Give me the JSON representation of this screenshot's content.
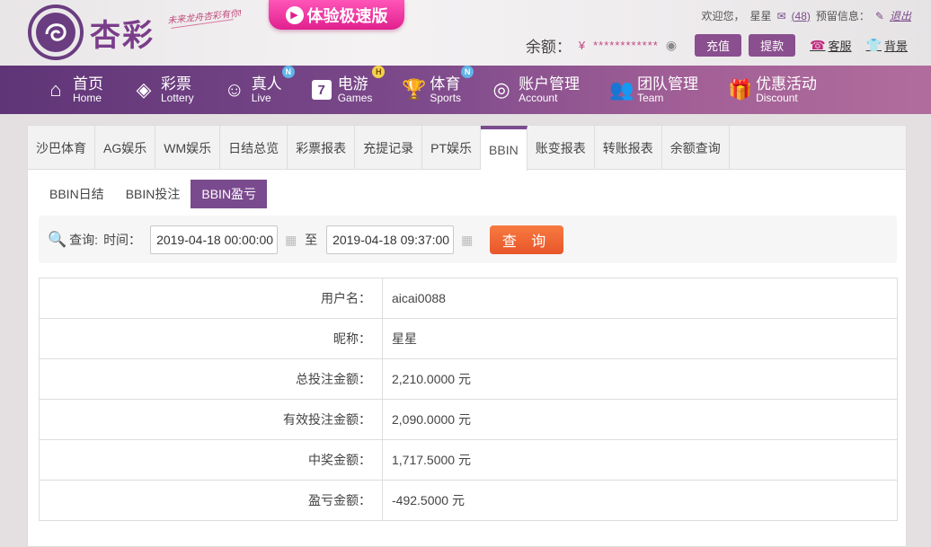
{
  "header": {
    "brand": "杏彩",
    "slogan": "未来龙舟杏彩有你!",
    "promo": "体验极速版",
    "welcome": "欢迎您，",
    "username": "星星",
    "message_count": "(48)",
    "alert_label": "预留信息：",
    "logout": "退出",
    "balance_label": "余额：",
    "balance_currency": "¥",
    "balance_masked": "************",
    "deposit": "充值",
    "withdraw": "提款",
    "service": "客服",
    "background": "背景"
  },
  "nav": [
    {
      "cn": "首页",
      "en": "Home",
      "icon": "home-icon",
      "badge": ""
    },
    {
      "cn": "彩票",
      "en": "Lottery",
      "icon": "lottery-icon",
      "badge": ""
    },
    {
      "cn": "真人",
      "en": "Live",
      "icon": "live-icon",
      "badge": "N"
    },
    {
      "cn": "电游",
      "en": "Games",
      "icon": "games-icon",
      "badge": "H"
    },
    {
      "cn": "体育",
      "en": "Sports",
      "icon": "sports-icon",
      "badge": "N"
    },
    {
      "cn": "账户管理",
      "en": "Account",
      "icon": "account-icon",
      "badge": ""
    },
    {
      "cn": "团队管理",
      "en": "Team",
      "icon": "team-icon",
      "badge": ""
    },
    {
      "cn": "优惠活动",
      "en": "Discount",
      "icon": "discount-icon",
      "badge": ""
    }
  ],
  "tabs": [
    "沙巴体育",
    "AG娱乐",
    "WM娱乐",
    "日结总览",
    "彩票报表",
    "充提记录",
    "PT娱乐",
    "BBIN",
    "账变报表",
    "转账报表",
    "余额查询"
  ],
  "active_tab": "BBIN",
  "subtabs": [
    "BBIN日结",
    "BBIN投注",
    "BBIN盈亏"
  ],
  "active_subtab": "BBIN盈亏",
  "search": {
    "label": "查询:",
    "time_label": "时间：",
    "start": "2019-04-18 00:00:00",
    "to": "至",
    "end": "2019-04-18 09:37:00",
    "button": "查 询"
  },
  "result": [
    {
      "label": "用户名：",
      "value": "aicai0088"
    },
    {
      "label": "昵称：",
      "value": "星星"
    },
    {
      "label": "总投注金额：",
      "value": "2,210.0000 元"
    },
    {
      "label": "有效投注金额：",
      "value": "2,090.0000 元"
    },
    {
      "label": "中奖金额：",
      "value": "1,717.5000 元"
    },
    {
      "label": "盈亏金额：",
      "value": "-492.5000 元"
    }
  ]
}
